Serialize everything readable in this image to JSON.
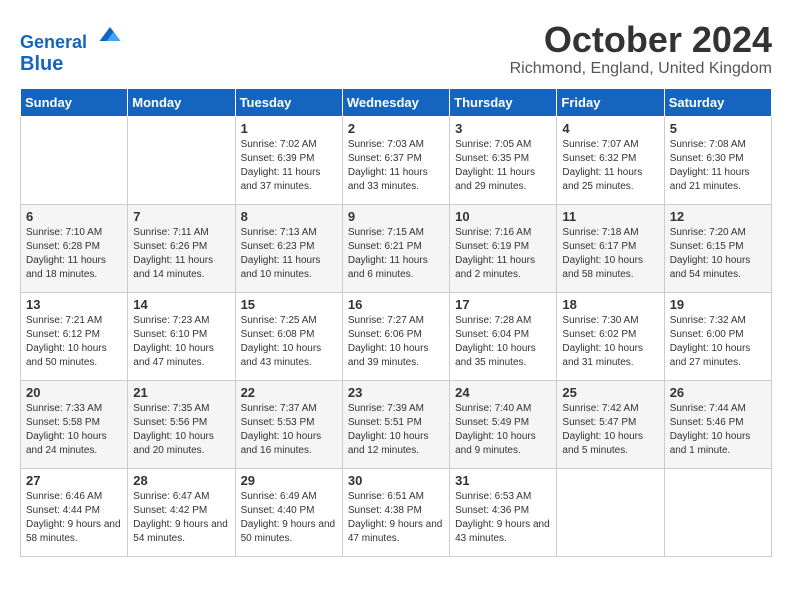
{
  "header": {
    "logo_line1": "General",
    "logo_line2": "Blue",
    "month_title": "October 2024",
    "location": "Richmond, England, United Kingdom"
  },
  "days_of_week": [
    "Sunday",
    "Monday",
    "Tuesday",
    "Wednesday",
    "Thursday",
    "Friday",
    "Saturday"
  ],
  "weeks": [
    [
      {
        "day": "",
        "content": ""
      },
      {
        "day": "",
        "content": ""
      },
      {
        "day": "1",
        "content": "Sunrise: 7:02 AM\nSunset: 6:39 PM\nDaylight: 11 hours and 37 minutes."
      },
      {
        "day": "2",
        "content": "Sunrise: 7:03 AM\nSunset: 6:37 PM\nDaylight: 11 hours and 33 minutes."
      },
      {
        "day": "3",
        "content": "Sunrise: 7:05 AM\nSunset: 6:35 PM\nDaylight: 11 hours and 29 minutes."
      },
      {
        "day": "4",
        "content": "Sunrise: 7:07 AM\nSunset: 6:32 PM\nDaylight: 11 hours and 25 minutes."
      },
      {
        "day": "5",
        "content": "Sunrise: 7:08 AM\nSunset: 6:30 PM\nDaylight: 11 hours and 21 minutes."
      }
    ],
    [
      {
        "day": "6",
        "content": "Sunrise: 7:10 AM\nSunset: 6:28 PM\nDaylight: 11 hours and 18 minutes."
      },
      {
        "day": "7",
        "content": "Sunrise: 7:11 AM\nSunset: 6:26 PM\nDaylight: 11 hours and 14 minutes."
      },
      {
        "day": "8",
        "content": "Sunrise: 7:13 AM\nSunset: 6:23 PM\nDaylight: 11 hours and 10 minutes."
      },
      {
        "day": "9",
        "content": "Sunrise: 7:15 AM\nSunset: 6:21 PM\nDaylight: 11 hours and 6 minutes."
      },
      {
        "day": "10",
        "content": "Sunrise: 7:16 AM\nSunset: 6:19 PM\nDaylight: 11 hours and 2 minutes."
      },
      {
        "day": "11",
        "content": "Sunrise: 7:18 AM\nSunset: 6:17 PM\nDaylight: 10 hours and 58 minutes."
      },
      {
        "day": "12",
        "content": "Sunrise: 7:20 AM\nSunset: 6:15 PM\nDaylight: 10 hours and 54 minutes."
      }
    ],
    [
      {
        "day": "13",
        "content": "Sunrise: 7:21 AM\nSunset: 6:12 PM\nDaylight: 10 hours and 50 minutes."
      },
      {
        "day": "14",
        "content": "Sunrise: 7:23 AM\nSunset: 6:10 PM\nDaylight: 10 hours and 47 minutes."
      },
      {
        "day": "15",
        "content": "Sunrise: 7:25 AM\nSunset: 6:08 PM\nDaylight: 10 hours and 43 minutes."
      },
      {
        "day": "16",
        "content": "Sunrise: 7:27 AM\nSunset: 6:06 PM\nDaylight: 10 hours and 39 minutes."
      },
      {
        "day": "17",
        "content": "Sunrise: 7:28 AM\nSunset: 6:04 PM\nDaylight: 10 hours and 35 minutes."
      },
      {
        "day": "18",
        "content": "Sunrise: 7:30 AM\nSunset: 6:02 PM\nDaylight: 10 hours and 31 minutes."
      },
      {
        "day": "19",
        "content": "Sunrise: 7:32 AM\nSunset: 6:00 PM\nDaylight: 10 hours and 27 minutes."
      }
    ],
    [
      {
        "day": "20",
        "content": "Sunrise: 7:33 AM\nSunset: 5:58 PM\nDaylight: 10 hours and 24 minutes."
      },
      {
        "day": "21",
        "content": "Sunrise: 7:35 AM\nSunset: 5:56 PM\nDaylight: 10 hours and 20 minutes."
      },
      {
        "day": "22",
        "content": "Sunrise: 7:37 AM\nSunset: 5:53 PM\nDaylight: 10 hours and 16 minutes."
      },
      {
        "day": "23",
        "content": "Sunrise: 7:39 AM\nSunset: 5:51 PM\nDaylight: 10 hours and 12 minutes."
      },
      {
        "day": "24",
        "content": "Sunrise: 7:40 AM\nSunset: 5:49 PM\nDaylight: 10 hours and 9 minutes."
      },
      {
        "day": "25",
        "content": "Sunrise: 7:42 AM\nSunset: 5:47 PM\nDaylight: 10 hours and 5 minutes."
      },
      {
        "day": "26",
        "content": "Sunrise: 7:44 AM\nSunset: 5:46 PM\nDaylight: 10 hours and 1 minute."
      }
    ],
    [
      {
        "day": "27",
        "content": "Sunrise: 6:46 AM\nSunset: 4:44 PM\nDaylight: 9 hours and 58 minutes."
      },
      {
        "day": "28",
        "content": "Sunrise: 6:47 AM\nSunset: 4:42 PM\nDaylight: 9 hours and 54 minutes."
      },
      {
        "day": "29",
        "content": "Sunrise: 6:49 AM\nSunset: 4:40 PM\nDaylight: 9 hours and 50 minutes."
      },
      {
        "day": "30",
        "content": "Sunrise: 6:51 AM\nSunset: 4:38 PM\nDaylight: 9 hours and 47 minutes."
      },
      {
        "day": "31",
        "content": "Sunrise: 6:53 AM\nSunset: 4:36 PM\nDaylight: 9 hours and 43 minutes."
      },
      {
        "day": "",
        "content": ""
      },
      {
        "day": "",
        "content": ""
      }
    ]
  ]
}
